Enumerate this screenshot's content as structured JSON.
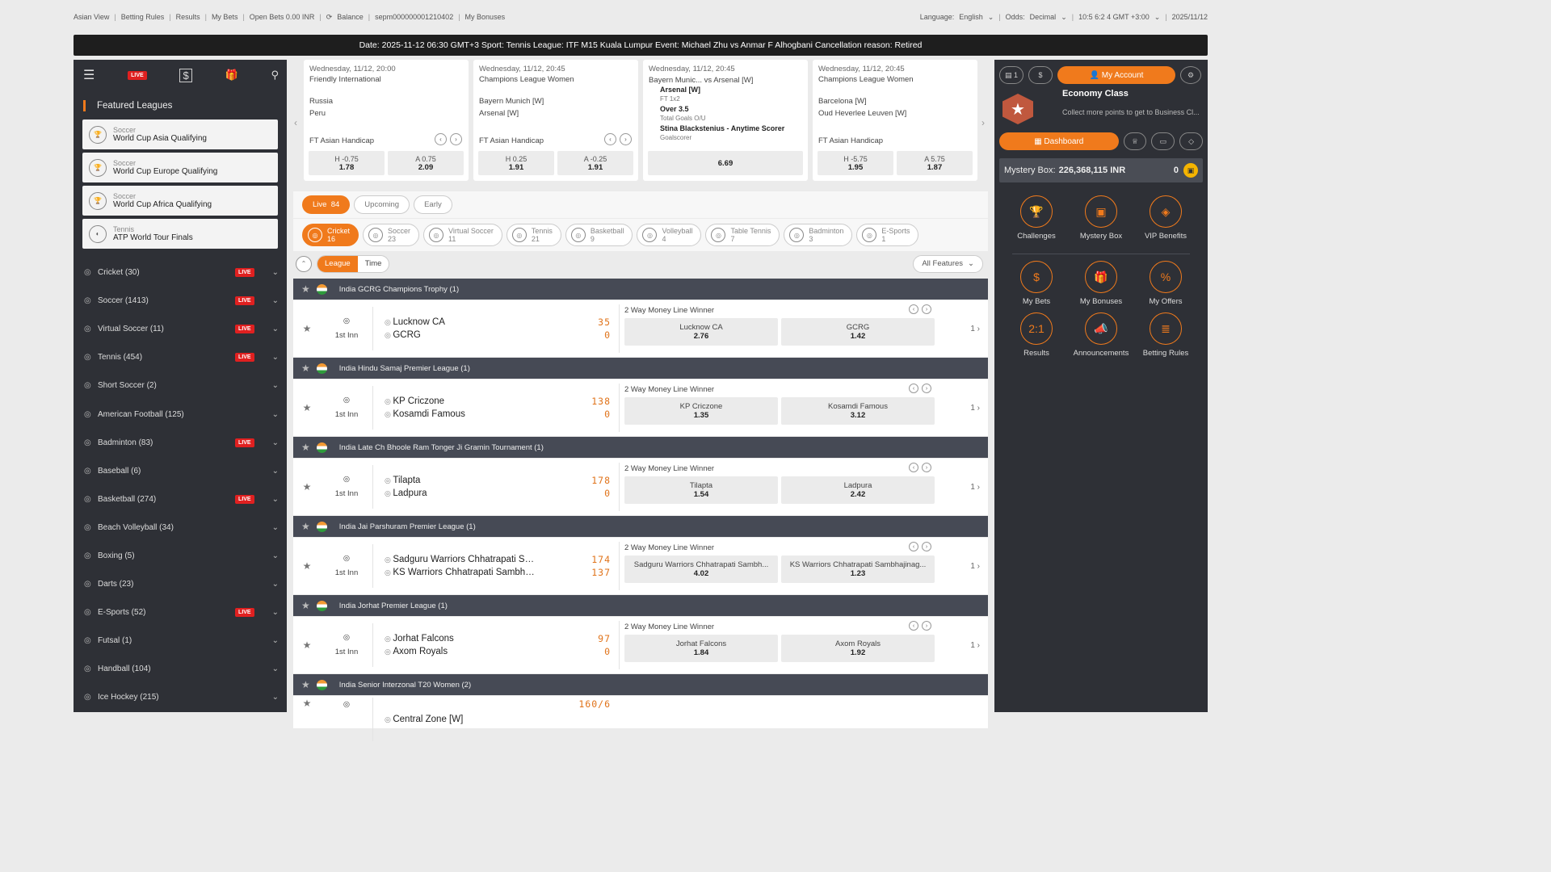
{
  "top_bar": {
    "left": [
      "Asian View",
      "Betting Rules",
      "Results",
      "My Bets",
      "Open Bets 0.00 INR"
    ],
    "balance_label": "Balance",
    "account_id": "sepm000000001210402",
    "my_bonuses": "My Bonuses",
    "language_label": "Language:",
    "language": "English",
    "odds_label": "Odds:",
    "odds": "Decimal",
    "time": "10:5 6:2 4 GMT +3:00",
    "date": "2025/11/12"
  },
  "ticker": "Date: 2025-11-12 06:30 GMT+3 Sport: Tennis League: ITF M15 Kuala Lumpur Event: Michael Zhu vs Anmar F Alhogbani Cancellation reason: Retired",
  "left_sidebar": {
    "live_label": "LIVE",
    "featured_title": "Featured Leagues",
    "featured": [
      {
        "sport": "Soccer",
        "league": "World Cup Asia Qualifying"
      },
      {
        "sport": "Soccer",
        "league": "World Cup Europe Qualifying"
      },
      {
        "sport": "Soccer",
        "league": "World Cup Africa Qualifying"
      },
      {
        "sport": "Tennis",
        "league": "ATP World Tour Finals"
      }
    ],
    "sports": [
      {
        "name": "Cricket (30)",
        "live": true
      },
      {
        "name": "Soccer (1413)",
        "live": true
      },
      {
        "name": "Virtual Soccer (11)",
        "live": true
      },
      {
        "name": "Tennis (454)",
        "live": true
      },
      {
        "name": "Short Soccer (2)",
        "live": false
      },
      {
        "name": "American Football (125)",
        "live": false
      },
      {
        "name": "Badminton (83)",
        "live": true
      },
      {
        "name": "Baseball (6)",
        "live": false
      },
      {
        "name": "Basketball (274)",
        "live": true
      },
      {
        "name": "Beach Volleyball (34)",
        "live": false
      },
      {
        "name": "Boxing (5)",
        "live": false
      },
      {
        "name": "Darts (23)",
        "live": false
      },
      {
        "name": "E-Sports (52)",
        "live": true
      },
      {
        "name": "Futsal (1)",
        "live": false
      },
      {
        "name": "Handball (104)",
        "live": false
      },
      {
        "name": "Ice Hockey (215)",
        "live": false
      }
    ]
  },
  "featured_events": [
    {
      "date": "Wednesday, 11/12, 20:00",
      "league": "Friendly International",
      "team1": "Russia",
      "team2": "Peru",
      "market": "FT Asian Handicap",
      "odds": [
        {
          "label": "H -0.75",
          "value": "1.78"
        },
        {
          "label": "A 0.75",
          "value": "2.09"
        }
      ]
    },
    {
      "date": "Wednesday, 11/12, 20:45",
      "league": "Champions League Women",
      "team1": "Bayern Munich [W]",
      "team2": "Arsenal [W]",
      "market": "FT Asian Handicap",
      "odds": [
        {
          "label": "H 0.25",
          "value": "1.91"
        },
        {
          "label": "A -0.25",
          "value": "1.91"
        }
      ]
    },
    {
      "date": "Wednesday, 11/12, 20:45",
      "league": "",
      "team1": "Bayern Munic...",
      "vs": "vs",
      "team2": "Arsenal [W]",
      "bet1": "Arsenal [W]",
      "bet1_sub": "FT 1x2",
      "bet2": "Over 3.5",
      "bet2_sub": "Total Goals O/U",
      "bet3": "Stina Blackstenius - Anytime Scorer",
      "bet3_sub": "Goalscorer",
      "odds": [
        {
          "label": "",
          "value": "6.69"
        }
      ]
    },
    {
      "date": "Wednesday, 11/12, 20:45",
      "league": "Champions League Women",
      "team1": "Barcelona [W]",
      "team2": "Oud Heverlee Leuven [W]",
      "market": "FT Asian Handicap",
      "odds": [
        {
          "label": "H -5.75",
          "value": "1.95"
        },
        {
          "label": "A 5.75",
          "value": "1.87"
        }
      ]
    }
  ],
  "tabs": [
    {
      "label": "Live",
      "count": "84"
    },
    {
      "label": "Upcoming"
    },
    {
      "label": "Early"
    }
  ],
  "sports_filter": [
    {
      "name": "Cricket",
      "count": "16",
      "icon": "cricket-icon"
    },
    {
      "name": "Soccer",
      "count": "23",
      "icon": "soccer-icon"
    },
    {
      "name": "Virtual Soccer",
      "count": "11",
      "icon": "virtual-soccer-icon"
    },
    {
      "name": "Tennis",
      "count": "21",
      "icon": "tennis-icon"
    },
    {
      "name": "Basketball",
      "count": "9",
      "icon": "basketball-icon"
    },
    {
      "name": "Volleyball",
      "count": "4",
      "icon": "volleyball-icon"
    },
    {
      "name": "Table Tennis",
      "count": "7",
      "icon": "table-tennis-icon"
    },
    {
      "name": "Badminton",
      "count": "3",
      "icon": "badminton-icon"
    },
    {
      "name": "E-Sports",
      "count": "1",
      "icon": "esports-icon"
    }
  ],
  "sort": {
    "league": "League",
    "time": "Time",
    "all_features": "All Features"
  },
  "leagues": [
    {
      "name": "India GCRG Champions Trophy (1)",
      "inn": "1st Inn",
      "team1": "Lucknow CA",
      "team2": "GCRG",
      "score1": "35",
      "score2": "0",
      "market": "2 Way Money Line Winner",
      "b1": "Lucknow CA",
      "o1": "2.76",
      "b2": "GCRG",
      "o2": "1.42",
      "more": "1"
    },
    {
      "name": "India Hindu Samaj Premier League (1)",
      "inn": "1st Inn",
      "team1": "KP Criczone",
      "team2": "Kosamdi Famous",
      "score1": "138",
      "score2": "0",
      "market": "2 Way Money Line Winner",
      "b1": "KP Criczone",
      "o1": "1.35",
      "b2": "Kosamdi Famous",
      "o2": "3.12",
      "more": "1"
    },
    {
      "name": "India Late Ch Bhoole Ram Tonger Ji Gramin Tournament (1)",
      "inn": "1st Inn",
      "team1": "Tilapta",
      "team2": "Ladpura",
      "score1": "178",
      "score2": "0",
      "market": "2 Way Money Line Winner",
      "b1": "Tilapta",
      "o1": "1.54",
      "b2": "Ladpura",
      "o2": "2.42",
      "more": "1"
    },
    {
      "name": "India Jai Parshuram Premier League (1)",
      "inn": "1st Inn",
      "team1": "Sadguru Warriors Chhatrapati Sambhajinag...",
      "team2": "KS Warriors Chhatrapati Sambhajinagar",
      "score1": "174",
      "score2": "137",
      "market": "2 Way Money Line Winner",
      "b1": "Sadguru Warriors Chhatrapati Sambh...",
      "o1": "4.02",
      "b2": "KS Warriors Chhatrapati Sambhajinag...",
      "o2": "1.23",
      "more": "1"
    },
    {
      "name": "India Jorhat Premier League (1)",
      "inn": "1st Inn",
      "team1": "Jorhat Falcons",
      "team2": "Axom Royals",
      "score1": "97",
      "score2": "0",
      "market": "2 Way Money Line Winner",
      "b1": "Jorhat Falcons",
      "o1": "1.84",
      "b2": "Axom Royals",
      "o2": "1.92",
      "more": "1"
    },
    {
      "name": "India Senior Interzonal T20 Women (2)",
      "team1": "Central Zone [W]",
      "score1": "160/6"
    }
  ],
  "right_sidebar": {
    "betslip_count": "1",
    "my_account": "My Account",
    "tier": "Economy Class",
    "tier_sub": "Collect more points to get to Business Cl...",
    "dashboard": "Dashboard",
    "mystery_label": "Mystery Box:",
    "mystery_value": "226,368,115 INR",
    "mystery_count": "0",
    "grid": [
      {
        "label": "Challenges",
        "icon": "trophy-icon",
        "glyph": "🏆"
      },
      {
        "label": "Mystery Box",
        "icon": "box-icon",
        "glyph": "▣"
      },
      {
        "label": "VIP Benefits",
        "icon": "diamond-icon",
        "glyph": "◈"
      },
      {
        "label": "My Bets",
        "icon": "bets-icon",
        "glyph": "$"
      },
      {
        "label": "My Bonuses",
        "icon": "gift-icon",
        "glyph": "🎁"
      },
      {
        "label": "My Offers",
        "icon": "offers-icon",
        "glyph": "%"
      },
      {
        "label": "Results",
        "icon": "results-icon",
        "glyph": "2:1"
      },
      {
        "label": "Announcements",
        "icon": "megaphone-icon",
        "glyph": "📣"
      },
      {
        "label": "Betting Rules",
        "icon": "rules-icon",
        "glyph": "≣"
      }
    ]
  }
}
